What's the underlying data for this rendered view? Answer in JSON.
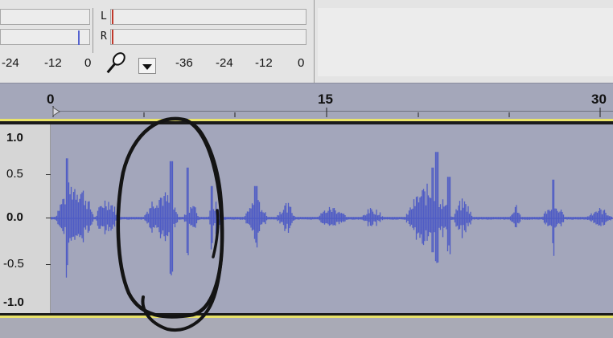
{
  "meters": {
    "playback_channels": [],
    "record_channels": [
      "L",
      "R"
    ],
    "playback_scale": [
      "-24",
      "-12",
      "0"
    ],
    "record_scale": [
      "-36",
      "-24",
      "-12",
      "0"
    ],
    "mic_icon": "microphone-icon",
    "dropdown_icon": "triangle-down-icon"
  },
  "ruler": {
    "labels": [
      "0",
      "15",
      "30"
    ]
  },
  "track": {
    "amplitude_labels": [
      "1.0",
      "0.5",
      "0.0",
      "-0.5",
      "-1.0"
    ],
    "waveform_color": "#4f5cc5",
    "background_color": "#a3a6bb",
    "annotation_color": "#111111"
  }
}
